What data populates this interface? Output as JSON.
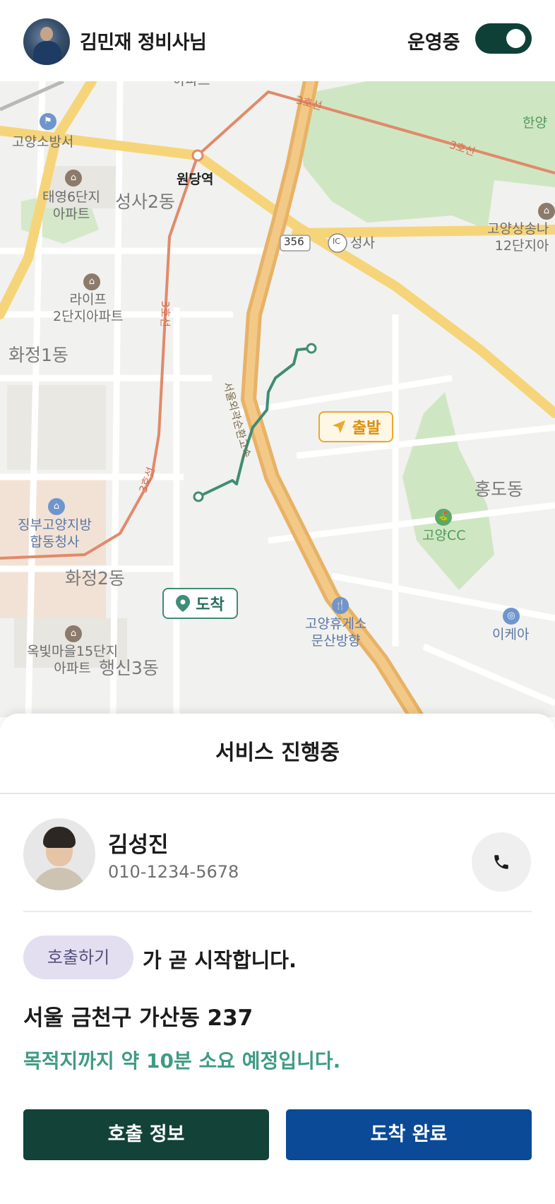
{
  "header": {
    "driver_name": "김민재 정비사님",
    "status_label": "운영중",
    "toggle_on": true,
    "toggle_color": "#0f4038"
  },
  "map": {
    "labels": {
      "apt_top": "아파트",
      "fire_station": "고양소방서",
      "station": "원당역",
      "taeyoung": "태영6단지\n아파트",
      "seongsa2": "성사2동",
      "road_356": "356",
      "seongsa_ic": "성사",
      "goyang_sangsong": "고양상송나\n12단지아",
      "line3_a": "3호선",
      "line3_b": "3호선",
      "line3_c": "3호선",
      "line3_d": "3호선",
      "life2": "라이프\n2단지아파트",
      "hwajeong1": "화정1동",
      "expressway": "서울외곽순환고속",
      "hongdo": "홍도동",
      "goyang_cc": "고양CC",
      "gov_office": "징부고양지방\n합동청사",
      "hwajeong2": "화정2동",
      "rest_area": "고양휴게소\n문산방향",
      "ikea": "이케아",
      "okbit": "옥빛마을15단지\n아파트",
      "haengsin3": "행신3동",
      "hanyang": "한양"
    },
    "start_marker": "출발",
    "end_marker": "도착",
    "route_color": "#3e8d74",
    "start_color": "#e9a92b"
  },
  "sheet": {
    "title": "서비스 진행중",
    "customer": {
      "name": "김성진",
      "phone": "010-1234-5678"
    },
    "call_badge": "호출하기",
    "start_text": "가 곧 시작합니다.",
    "address": "서울 금천구 가산동 237",
    "eta": "목적지까지 약 10분 소요 예정입니다.",
    "buttons": {
      "info": "호출 정보",
      "done": "도착 완료"
    },
    "colors": {
      "info_button": "#124238",
      "done_button": "#0a4a97",
      "eta_text": "#3f9b83",
      "badge_bg": "#e3dff1"
    }
  }
}
